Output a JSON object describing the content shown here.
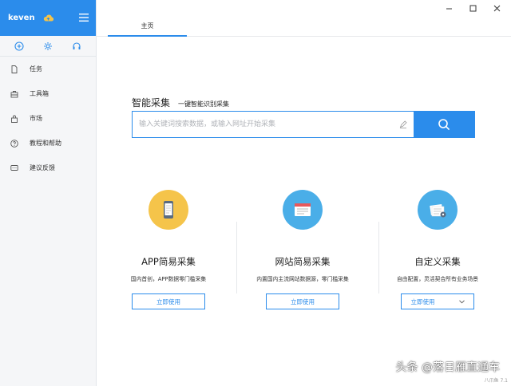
{
  "sidebar": {
    "user": "keven",
    "items": [
      {
        "label": "任务",
        "icon": "file-icon"
      },
      {
        "label": "工具箱",
        "icon": "toolbox-icon"
      },
      {
        "label": "市场",
        "icon": "bag-icon"
      },
      {
        "label": "教程和帮助",
        "icon": "help-icon"
      },
      {
        "label": "建议反馈",
        "icon": "feedback-icon"
      }
    ]
  },
  "tabs": [
    {
      "label": "主页"
    }
  ],
  "search": {
    "title": "智能采集",
    "subtitle": "一键智能识别采集",
    "placeholder": "输入关键词搜索数据，或输入网址开始采集"
  },
  "cards": [
    {
      "title": "APP简易采集",
      "desc": "国内首创，APP数据零门槛采集",
      "button": "立即使用",
      "color": "#f5c44a"
    },
    {
      "title": "网站简易采集",
      "desc": "内置国内主流网站数据源，零门槛采集",
      "button": "立即使用",
      "color": "#4aaee8"
    },
    {
      "title": "自定义采集",
      "desc": "自由配置，灵活契合所有业务场景",
      "button": "立即使用",
      "color": "#4aaee8"
    }
  ],
  "watermark": "头条 @落日雁直通车",
  "version": "八爪鱼 7.1",
  "colors": {
    "accent": "#2b8ceb"
  }
}
